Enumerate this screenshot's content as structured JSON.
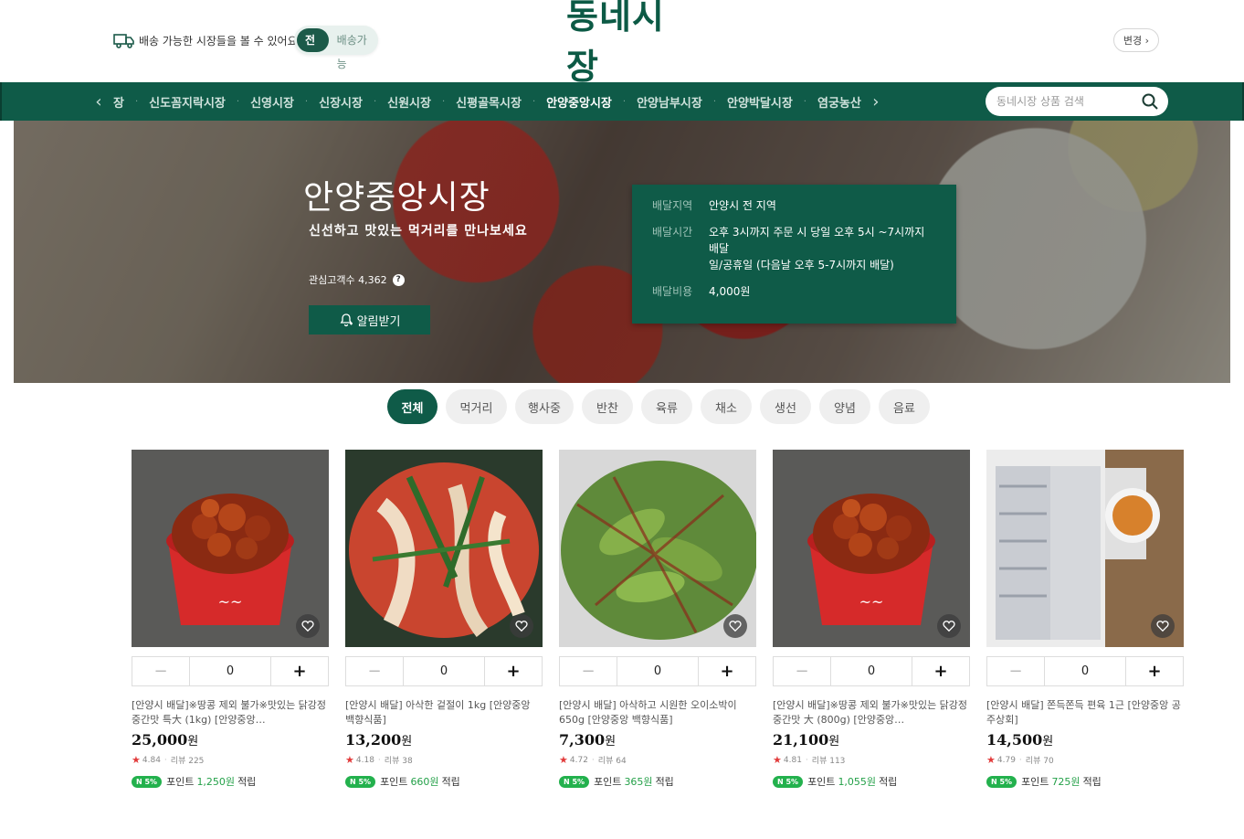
{
  "header": {
    "delivery_note": "배송 가능한 시장들을 볼 수 있어요.",
    "toggle_all": "전체",
    "toggle_deliverable": "배송가능",
    "logo": "동네시장",
    "change_button": "변경 ›"
  },
  "nav": {
    "prev_arrow": "‹",
    "next_arrow": "›",
    "items": [
      {
        "label": "장"
      },
      {
        "label": "신도꼼지락시장"
      },
      {
        "label": "신영시장"
      },
      {
        "label": "신장시장"
      },
      {
        "label": "신원시장"
      },
      {
        "label": "신평골목시장"
      },
      {
        "label": "안양중앙시장"
      },
      {
        "label": "안양남부시장"
      },
      {
        "label": "안양박달시장"
      },
      {
        "label": "염궁농산"
      }
    ],
    "active_index": 6,
    "search_placeholder": "동네시장 상품 검색"
  },
  "hero": {
    "title": "안양중앙시장",
    "subtitle": "신선하고 맛있는 먹거리를 만나보세요",
    "fans_label": "관심고객수 4,362",
    "help": "?",
    "alert_button": "알림받기",
    "info": {
      "area_label": "배달지역",
      "area_value": "안양시 전 지역",
      "time_label": "배달시간",
      "time_value_1": "오후 3시까지 주문 시 당일 오후 5시 ~7시까지 배달",
      "time_value_2": "일/공휴일 (다음날 오후 5-7시까지 배달)",
      "cost_label": "배달비용",
      "cost_value": "4,000원"
    }
  },
  "categories": [
    "전체",
    "먹거리",
    "행사중",
    "반찬",
    "육류",
    "채소",
    "생선",
    "양념",
    "음료"
  ],
  "active_category": 0,
  "products": [
    {
      "name": "[안양시 배달]※땅콩 제외 불가※맛있는 닭강정 중간맛 특大 (1kg) [안양중앙…",
      "price": "25,000",
      "won": "원",
      "rating": "4.84",
      "reviews": "리뷰 225",
      "points": "1,250원",
      "qty": "0",
      "image": "chicken"
    },
    {
      "name": "[안양시 배달] 아삭한 겉절이 1kg [안양중앙 백향식품]",
      "price": "13,200",
      "won": "원",
      "rating": "4.18",
      "reviews": "리뷰 38",
      "points": "660원",
      "qty": "0",
      "image": "kimchi"
    },
    {
      "name": "[안양시 배달] 아삭하고 시원한 오이소박이 650g [안양중앙 백향식품]",
      "price": "7,300",
      "won": "원",
      "rating": "4.72",
      "reviews": "리뷰 64",
      "points": "365원",
      "qty": "0",
      "image": "cucumber"
    },
    {
      "name": "[안양시 배달]※땅콩 제외 불가※맛있는 닭강정 중간맛 大 (800g) [안양중앙…",
      "price": "21,100",
      "won": "원",
      "rating": "4.81",
      "reviews": "리뷰 113",
      "points": "1,055원",
      "qty": "0",
      "image": "chicken"
    },
    {
      "name": "[안양시 배달] 쫀득쫀득 편육 1근 [안양중앙 공주상회]",
      "price": "14,500",
      "won": "원",
      "rating": "4.79",
      "reviews": "리뷰 70",
      "points": "725원",
      "qty": "0",
      "image": "pork"
    }
  ],
  "labels": {
    "npay": "N 5%",
    "points_prefix": "포인트",
    "points_suffix": "적립",
    "minus": "−",
    "plus": "+"
  },
  "colors": {
    "brand_green": "#0f5b48",
    "star_red": "#e23b3b",
    "npay_green": "#23b14d"
  }
}
